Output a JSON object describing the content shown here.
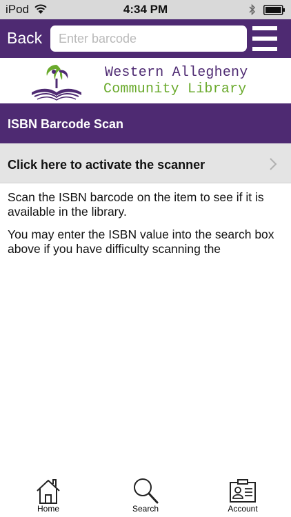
{
  "status_bar": {
    "carrier": "iPod",
    "time": "4:34 PM",
    "icons": [
      "wifi-icon",
      "bluetooth-icon",
      "battery-icon"
    ]
  },
  "header": {
    "back_label": "Back",
    "search_placeholder": "Enter barcode",
    "search_value": "",
    "menu_icon": "hamburger-menu-icon"
  },
  "logo": {
    "line1": "Western Allegheny",
    "line2": "Community Library",
    "icon": "library-logo-icon"
  },
  "page": {
    "title": "ISBN Barcode Scan",
    "scanner_link": "Click here to activate the scanner",
    "paragraphs": [
      "Scan the ISBN barcode on the item to see if it is available in the library.",
      "You may enter the ISBN value into the search box above if you have difficulty scanning the"
    ]
  },
  "tab_bar": {
    "tabs": [
      {
        "label": "Home",
        "icon": "home-icon"
      },
      {
        "label": "Search",
        "icon": "search-icon"
      },
      {
        "label": "Account",
        "icon": "account-card-icon"
      }
    ]
  },
  "colors": {
    "brand_purple": "#4e2a72",
    "brand_green": "#6aaa2c",
    "status_bar": "#d9d9d9",
    "row_gray": "#e4e4e4"
  }
}
